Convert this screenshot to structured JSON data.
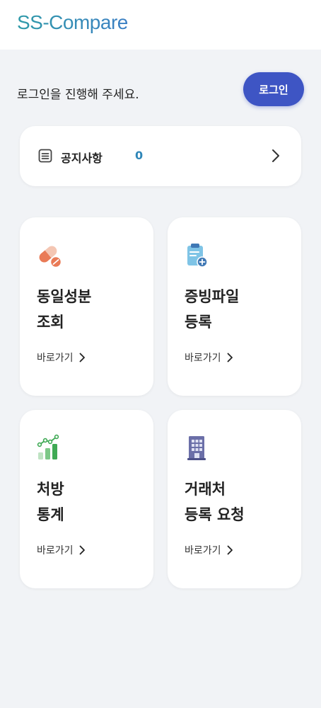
{
  "header": {
    "logo_text": "SS-Compare"
  },
  "login": {
    "message": "로그인을 진행해 주세요.",
    "button_label": "로그인"
  },
  "notice": {
    "label": "공지사항",
    "count": "0",
    "icon": "document-list-icon"
  },
  "cards": [
    {
      "title_line1": "동일성분",
      "title_line2": "조회",
      "link_label": "바로가기",
      "icon": "pill-icon"
    },
    {
      "title_line1": "증빙파일",
      "title_line2": "등록",
      "link_label": "바로가기",
      "icon": "clipboard-add-icon"
    },
    {
      "title_line1": "처방",
      "title_line2": "통계",
      "link_label": "바로가기",
      "icon": "bar-chart-icon"
    },
    {
      "title_line1": "거래처",
      "title_line2": "등록 요청",
      "link_label": "바로가기",
      "icon": "building-icon"
    }
  ],
  "colors": {
    "accent": "#3e55c4",
    "logo": "#3a8fb5",
    "count": "#2f86b8",
    "background": "#f1f3f6"
  }
}
